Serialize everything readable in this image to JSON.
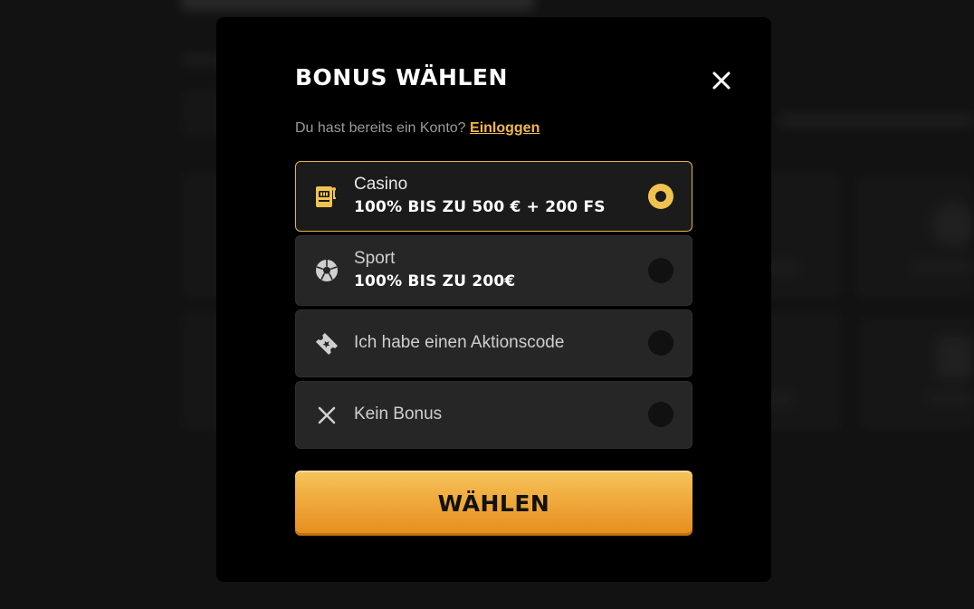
{
  "modal": {
    "title": "BONUS WÄHLEN",
    "login_prompt": "Du hast bereits ein Konto?",
    "login_link": "Einloggen",
    "options": [
      {
        "label": "Casino",
        "sub": "100% BIS ZU 500 € + 200 FS",
        "icon": "slot-machine-icon",
        "selected": true
      },
      {
        "label": "Sport",
        "sub": "100% BIS ZU 200€",
        "icon": "soccer-ball-icon",
        "selected": false
      },
      {
        "label": "Ich habe einen Aktionscode",
        "icon": "promo-ticket-icon",
        "selected": false
      },
      {
        "label": "Kein Bonus",
        "icon": "close-x-icon",
        "selected": false
      }
    ],
    "choose_button": "WÄHLEN"
  },
  "colors": {
    "accent": "#f0c350",
    "button_top": "#f6c45e",
    "button_bottom": "#e48d1d",
    "link": "#f2b84a",
    "modal_bg": "#000000"
  }
}
